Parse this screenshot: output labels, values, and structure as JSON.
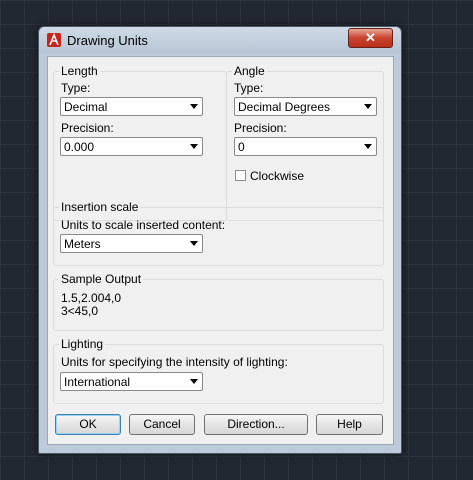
{
  "window": {
    "title": "Drawing Units",
    "close_label": "✕"
  },
  "length": {
    "legend": "Length",
    "type_label": "Type:",
    "type_value": "Decimal",
    "precision_label": "Precision:",
    "precision_value": "0.000"
  },
  "angle": {
    "legend": "Angle",
    "type_label": "Type:",
    "type_value": "Decimal Degrees",
    "precision_label": "Precision:",
    "precision_value": "0",
    "clockwise_label": "Clockwise",
    "clockwise_checked": false
  },
  "insertion": {
    "legend": "Insertion scale",
    "units_label": "Units to scale inserted content:",
    "units_value": "Meters"
  },
  "sample": {
    "legend": "Sample Output",
    "line1": "1.5,2.004,0",
    "line2": "3<45,0"
  },
  "lighting": {
    "legend": "Lighting",
    "units_label": "Units for specifying the intensity of lighting:",
    "units_value": "International"
  },
  "buttons": {
    "ok": "OK",
    "cancel": "Cancel",
    "direction": "Direction...",
    "help": "Help"
  }
}
